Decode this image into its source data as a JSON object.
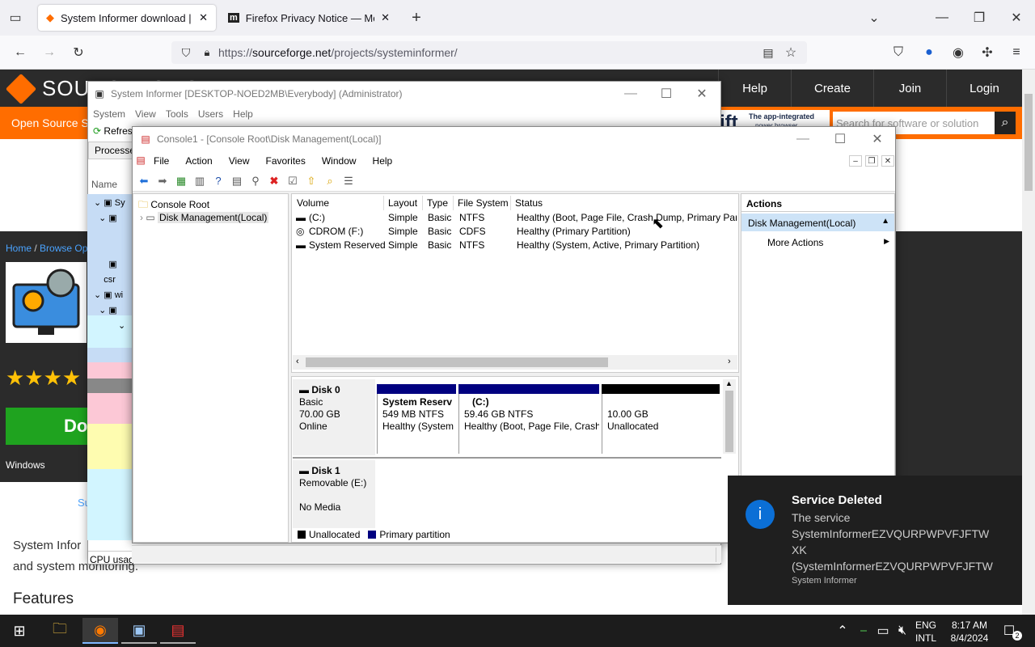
{
  "browser": {
    "tabs": [
      {
        "label": "System Informer download | Sc"
      },
      {
        "label": "Firefox Privacy Notice — Mozill"
      }
    ],
    "url_prefix": "https://",
    "url_domain": "sourceforge.net",
    "url_path": "/projects/systeminformer/"
  },
  "sourceforge": {
    "logo": "SOURCEFORGE",
    "nav": [
      "Help",
      "Create",
      "Join",
      "Login"
    ],
    "orange_text": "Open Source Sc",
    "search_placeholder": "Search for software or solution",
    "ad_text": "The app-integrated",
    "ad_sub": "power browser",
    "ad_brand": "ift",
    "breadcrumb_home": "Home",
    "breadcrumb_sep": "/",
    "breadcrumb_browse": "Browse Op",
    "rating": "★★★★",
    "download": "Do",
    "os": "Windows",
    "link": "Su",
    "desc1": "System Infor",
    "desc2": "and system monitoring.",
    "features": "Features"
  },
  "system_informer": {
    "title": "System Informer [DESKTOP-NOED2MB\\Everybody] (Administrator)",
    "menu": [
      "System",
      "View",
      "Tools",
      "Users",
      "Help"
    ],
    "refresh": "Refres",
    "tab": "Processe",
    "col_name": "Name",
    "rows": [
      "Sy",
      "",
      "",
      "",
      "csr",
      "wi",
      ""
    ],
    "cpu": "CPU usag"
  },
  "mmc": {
    "title": "Console1 - [Console Root\\Disk Management(Local)]",
    "menu": [
      "File",
      "Action",
      "View",
      "Favorites",
      "Window",
      "Help"
    ],
    "tree": {
      "root": "Console Root",
      "child": "Disk Management(Local)"
    },
    "columns": [
      "Volume",
      "Layout",
      "Type",
      "File System",
      "Status"
    ],
    "volumes": [
      {
        "name": "(C:)",
        "layout": "Simple",
        "type": "Basic",
        "fs": "NTFS",
        "status": "Healthy (Boot, Page File, Crash Dump, Primary Parti"
      },
      {
        "name": "CDROM (F:)",
        "layout": "Simple",
        "type": "Basic",
        "fs": "CDFS",
        "status": "Healthy (Primary Partition)"
      },
      {
        "name": "System Reserved",
        "layout": "Simple",
        "type": "Basic",
        "fs": "NTFS",
        "status": "Healthy (System, Active, Primary Partition)"
      }
    ],
    "disk0": {
      "name": "Disk 0",
      "type": "Basic",
      "size": "70.00 GB",
      "state": "Online",
      "parts": [
        {
          "title": "System Reserv",
          "size": "549 MB NTFS",
          "status": "Healthy (System"
        },
        {
          "title": "(C:)",
          "size": "59.46 GB NTFS",
          "status": "Healthy (Boot, Page File, Crash"
        },
        {
          "title": "",
          "size": "10.00 GB",
          "status": "Unallocated"
        }
      ]
    },
    "disk1": {
      "name": "Disk 1",
      "type": "Removable (E:)",
      "state": "No Media"
    },
    "legend": {
      "unallocated": "Unallocated",
      "primary": "Primary partition"
    },
    "actions": {
      "header": "Actions",
      "section": "Disk Management(Local)",
      "more": "More Actions"
    },
    "colors": {
      "primary": "#000080",
      "unallocated": "#000000"
    }
  },
  "toast": {
    "title": "Service Deleted",
    "line1": "The service",
    "line2": "SystemInformerEZVQURPWPVFJFTW",
    "line3": "XK",
    "line4": "(SystemInformerEZVQURPWPVFJFTW",
    "source": "System Informer"
  },
  "taskbar": {
    "lang1": "ENG",
    "lang2": "INTL",
    "time": "8:17 AM",
    "date": "8/4/2024",
    "notif": "2"
  }
}
